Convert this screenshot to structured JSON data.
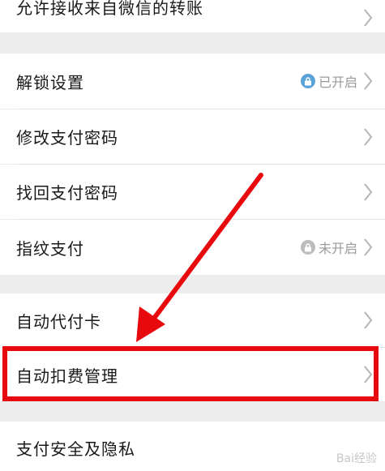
{
  "menu": {
    "allow_wechat_transfer": "允许接收来自微信的转账",
    "unlock_settings": "解锁设置",
    "unlock_status": "已开启",
    "change_pay_password": "修改支付密码",
    "recover_pay_password": "找回支付密码",
    "fingerprint_pay": "指纹支付",
    "fingerprint_status": "未开启",
    "auto_pay_card": "自动代付卡",
    "auto_deduct_manage": "自动扣费管理",
    "pay_security_privacy": "支付安全及隐私"
  },
  "watermark_text": "Bai经验",
  "colors": {
    "highlight": "#e8090f",
    "status_on": "#5aa3d8",
    "status_off": "#bdbdbd"
  }
}
